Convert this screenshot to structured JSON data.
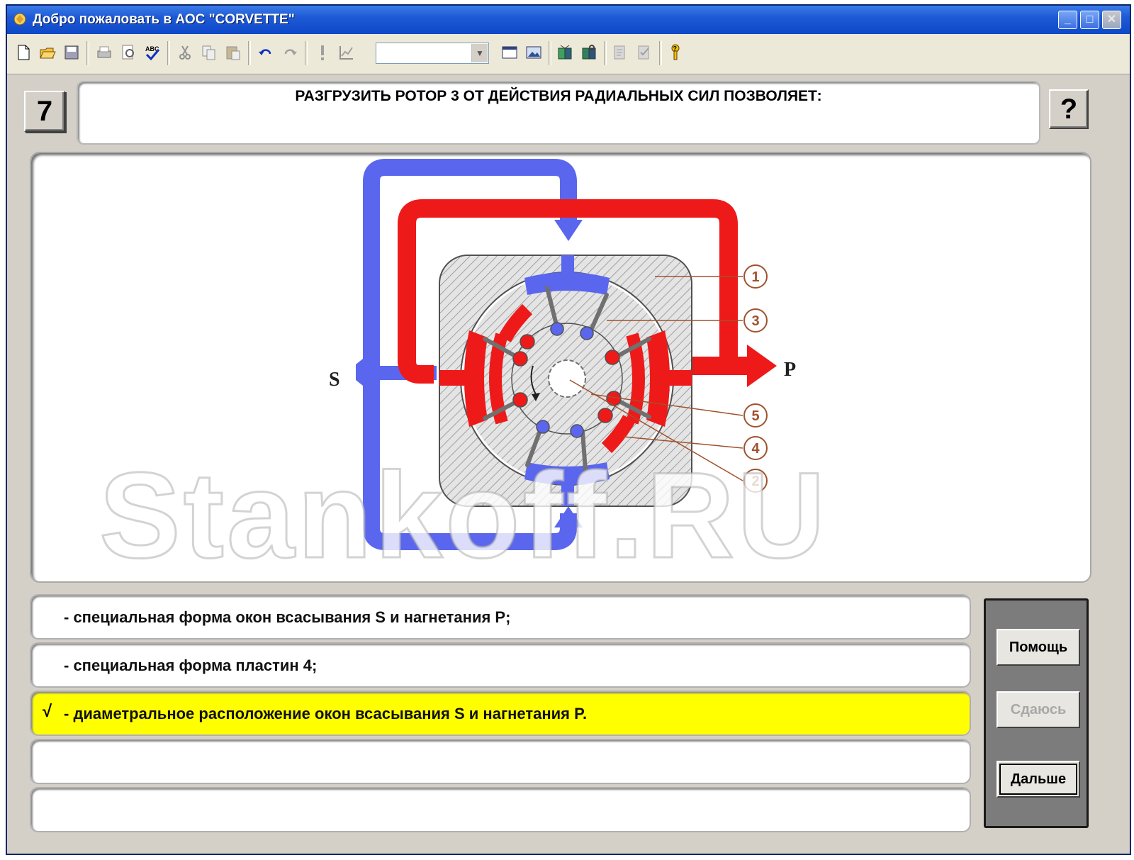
{
  "window": {
    "title": "Добро пожаловать в АОС \"CORVETTE\""
  },
  "toolbar": {
    "buttons": [
      "new-icon",
      "open-icon",
      "save-icon",
      "print-icon",
      "print-preview-icon",
      "spellcheck-icon",
      "cut-icon",
      "copy-icon",
      "paste-icon",
      "undo-icon",
      "redo-icon",
      "exclamation-icon",
      "chart-icon",
      "window-icon",
      "image-icon",
      "book-open-icon",
      "book-search-icon",
      "notes-icon",
      "checklist-icon",
      "help-key-icon"
    ],
    "combo_value": ""
  },
  "question": {
    "number": "7",
    "text": "РАЗГРУЗИТЬ РОТОР 3 ОТ ДЕЙСТВИЯ РАДИАЛЬНЫХ СИЛ ПОЗВОЛЯЕТ:",
    "help_symbol": "?"
  },
  "diagram": {
    "label_s": "S",
    "label_p": "P",
    "callouts": [
      "1",
      "3",
      "5",
      "4",
      "2"
    ],
    "colors": {
      "suction": "#5a66ee",
      "pressure": "#ee1a1a",
      "callout": "#a0522d"
    }
  },
  "answers": [
    {
      "text": "- специальная форма окон всасывания S и нагнетания P;",
      "selected": false,
      "mark": ""
    },
    {
      "text": "- специальная форма пластин 4;",
      "selected": false,
      "mark": ""
    },
    {
      "text": "- диаметральное расположение окон всасывания S и нагнетания P.",
      "selected": true,
      "mark": "√"
    },
    {
      "text": "",
      "selected": false,
      "mark": ""
    },
    {
      "text": "",
      "selected": false,
      "mark": ""
    }
  ],
  "buttons": {
    "help": "Помощь",
    "give_up": "Сдаюсь",
    "next": "Дальше"
  },
  "watermark": "Stankoff.RU"
}
